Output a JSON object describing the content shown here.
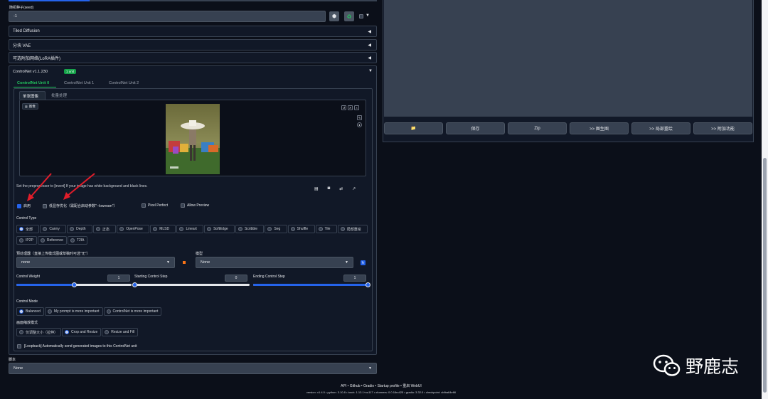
{
  "seed": {
    "label": "随机种子(seed)",
    "value": "-1",
    "dice_icon": "dice-icon",
    "recycle_icon": "recycle-icon",
    "extra_toggle": "▼"
  },
  "accordions": {
    "tiled_diffusion": "Tiled Diffusion",
    "tiled_vae": "分块 VAE",
    "lora_network": "可选附加网络(LoRA插件)",
    "collapsed_icon": "◀",
    "expanded_icon": "▼"
  },
  "controlnet": {
    "title": "ControlNet v1.1.230",
    "badge": "1 unit",
    "unit_tabs": [
      "ControlNet Unit 0",
      "ControlNet Unit 1",
      "ControlNet Unit 2"
    ],
    "image_tabs": [
      "单张图像",
      "批量处理"
    ],
    "image_label": "图像",
    "hint": "Set the preprocessor to [invert] If your image has white background and black lines.",
    "enable": "启用",
    "low_vram": "低显存优化（需配合启动参数\"--lowvram\"）",
    "pixel_perfect": "Pixel Perfect",
    "allow_preview": "Allow Preview",
    "control_type_label": "Control Type",
    "control_types_row1": [
      "全部",
      "Canny",
      "Depth",
      "正态",
      "OpenPose",
      "MLSD",
      "Lineart",
      "SoftEdge",
      "Scribble",
      "Seg",
      "Shuffle",
      "Tile",
      "局部重绘"
    ],
    "control_types_row2": [
      "IP2P",
      "Reference",
      "T2IA"
    ],
    "preprocessor_label": "预处理器（直接上传模式图或草稿时可选\"无\"）",
    "preprocessor_value": "none",
    "model_label": "模型",
    "model_value": "None",
    "control_weight_label": "Control Weight",
    "control_weight_value": "1",
    "control_weight": 0.5,
    "start_step_label": "Starting Control Step",
    "start_step_value": "0",
    "start_step": 0.0,
    "end_step_label": "Ending Control Step",
    "end_step_value": "1",
    "end_step": 1.0,
    "control_mode_label": "Control Mode",
    "control_modes": [
      "Balanced",
      "My prompt is more important",
      "ControlNet is more important"
    ],
    "resize_mode_label": "画面缩放模式",
    "resize_modes": [
      "仅调整大小（拉伸）",
      "Crop and Resize",
      "Resize and Fill"
    ],
    "loopback": "[Loopback] Automatically send generated images to this ControlNet unit"
  },
  "script": {
    "label": "脚本",
    "value": "None"
  },
  "output_buttons": [
    "📁",
    "保存",
    "Zip",
    ">> 图生图",
    ">> 局部重绘",
    ">> 附加功能"
  ],
  "footer": {
    "links": [
      "API",
      "Github",
      "Gradio",
      "Startup profile",
      "重启 WebUI"
    ],
    "versions": "version: v1.4.0  •  python: 3.10.8  •  torch: 1.13.1+cu117  •  xformers: 0.0.16rc425  •  gradio: 3.32.0  •  checkpoint: cbfba64e66"
  },
  "watermark": {
    "text": "野鹿志",
    "icon": "wechat-icon"
  },
  "colors": {
    "accent": "#2563eb",
    "badge": "#16a34a",
    "arrow": "#e11d2a",
    "tab_active": "#22c55e"
  }
}
